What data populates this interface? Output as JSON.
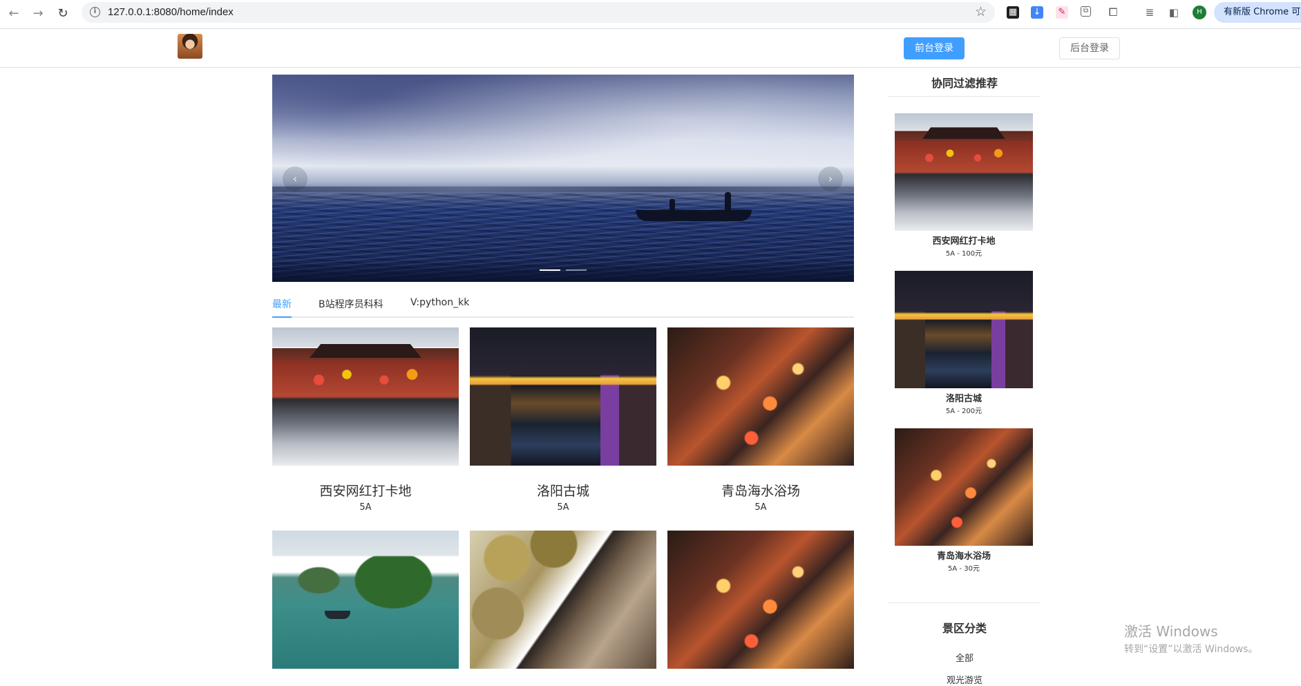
{
  "browser": {
    "url": "127.0.0.1:8080/home/index",
    "update_label": "有新版 Chrome 可用",
    "profile_initial": "H"
  },
  "header": {
    "front_login": "前台登录",
    "back_login": "后台登录"
  },
  "tabs": [
    {
      "label": "最新"
    },
    {
      "label": "B站程序员科科"
    },
    {
      "label": "V:python_kk"
    }
  ],
  "spots": [
    {
      "name": "西安网红打卡地",
      "level": "5A",
      "image": "city-gate"
    },
    {
      "name": "洛阳古城",
      "level": "5A",
      "image": "night-canal"
    },
    {
      "name": "青岛海水浴场",
      "level": "5A",
      "image": "night-street"
    },
    {
      "name": "",
      "level": "",
      "image": "lake-island"
    },
    {
      "name": "",
      "level": "",
      "image": "autumn-eaves"
    },
    {
      "name": "",
      "level": "",
      "image": "night-street"
    }
  ],
  "sidebar": {
    "rec_title": "协同过滤推荐",
    "recommendations": [
      {
        "name": "西安网红打卡地",
        "info": "5A - 100元"
      },
      {
        "name": "洛阳古城",
        "info": "5A - 200元"
      },
      {
        "name": "青岛海水浴场",
        "info": "5A - 30元"
      }
    ],
    "cat_title": "景区分类",
    "categories": [
      {
        "label": "全部"
      },
      {
        "label": "观光游览"
      }
    ]
  },
  "watermark": {
    "line1": "激活 Windows",
    "line2": "转到“设置”以激活 Windows。"
  },
  "colors": {
    "primary": "#409eff",
    "text": "#303133",
    "border": "#dcdfe6"
  }
}
